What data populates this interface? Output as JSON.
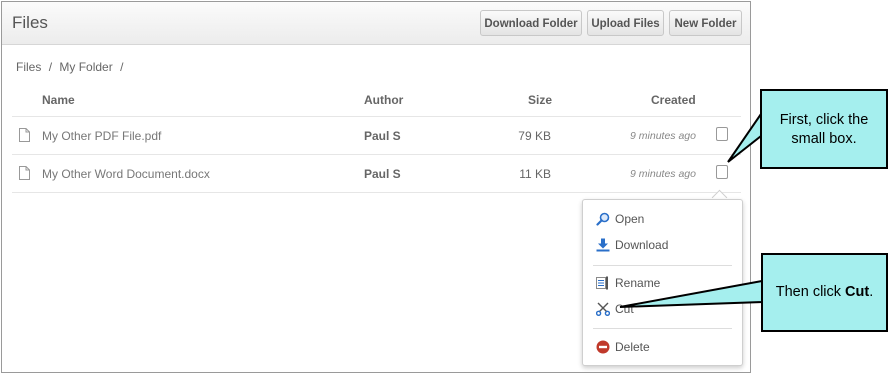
{
  "header": {
    "title": "Files",
    "buttons": {
      "download_folder": "Download Folder",
      "upload_files": "Upload Files",
      "new_folder": "New Folder"
    }
  },
  "breadcrumb": [
    "Files",
    "/",
    "My Folder",
    "/"
  ],
  "table": {
    "columns": [
      "Name",
      "Author",
      "Size",
      "Created"
    ],
    "rows": [
      {
        "name": "My Other PDF File.pdf",
        "author": "Paul S",
        "size": "79 KB",
        "created": "9 minutes ago"
      },
      {
        "name": "My Other Word Document.docx",
        "author": "Paul S",
        "size": "11 KB",
        "created": "9 minutes ago"
      }
    ]
  },
  "context_menu": {
    "items": [
      {
        "label": "Open",
        "icon": "magnifier-icon"
      },
      {
        "label": "Download",
        "icon": "download-arrow-icon"
      },
      {
        "label": "Rename",
        "icon": "rename-icon"
      },
      {
        "label": "Cut",
        "icon": "scissors-icon"
      },
      {
        "label": "Delete",
        "icon": "delete-circle-icon"
      }
    ]
  },
  "callouts": {
    "first": "First, click the small box.",
    "second_prefix": "Then click ",
    "second_bold": "Cut",
    "second_suffix": "."
  },
  "colors": {
    "callout_fill": "#a5efee",
    "delete_red": "#c0392b",
    "link_blue": "#2a6fc9"
  }
}
